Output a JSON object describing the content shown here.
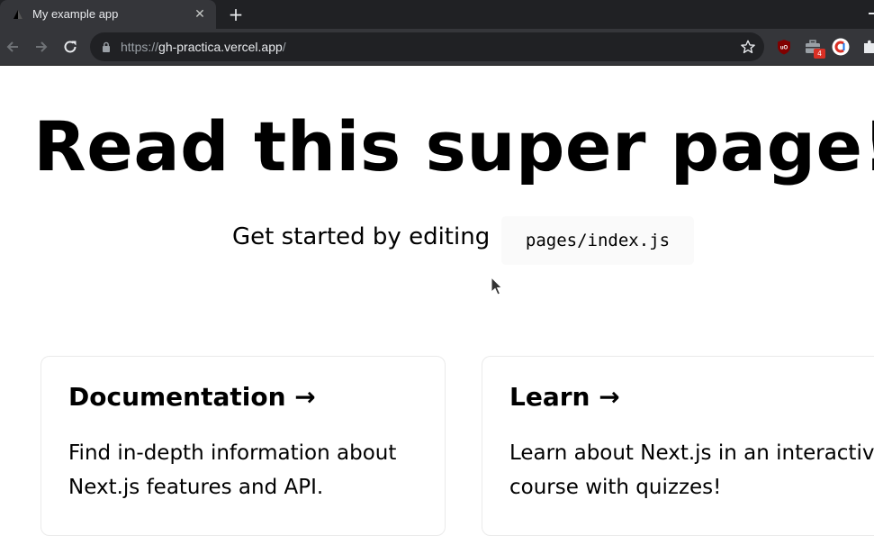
{
  "browser": {
    "tab_title": "My example app",
    "tab_close": "✕",
    "new_tab": "+",
    "url_scheme": "https://",
    "url_host": "gh-practica.vercel.app",
    "url_path": "/",
    "extension_badge": "4"
  },
  "page": {
    "title": "Read this super page!",
    "description": "Get started by editing",
    "code": "pages/index.js",
    "cards": [
      {
        "title": "Documentation →",
        "description": "Find in-depth information about Next.js features and API."
      },
      {
        "title": "Learn →",
        "description": "Learn about Next.js in an interactive course with quizzes!"
      }
    ]
  },
  "icons": {
    "favicon": "vercel-triangle-icon",
    "back": "arrow-left-icon",
    "forward": "arrow-right-icon",
    "reload": "reload-icon",
    "lock": "lock-icon",
    "star": "star-icon",
    "ublock": "ublock-origin-extension-icon",
    "toolbox": "toolbox-extension-icon",
    "c_extension": "c-extension-icon",
    "puzzle": "extensions-puzzle-icon"
  },
  "colors": {
    "tabbar": "#202124",
    "toolbar": "#35363a",
    "omnibox": "#202124",
    "badge": "#d93025",
    "page_background": "#ffffff",
    "code_background": "#fafafa",
    "card_border": "#eaeaea"
  }
}
